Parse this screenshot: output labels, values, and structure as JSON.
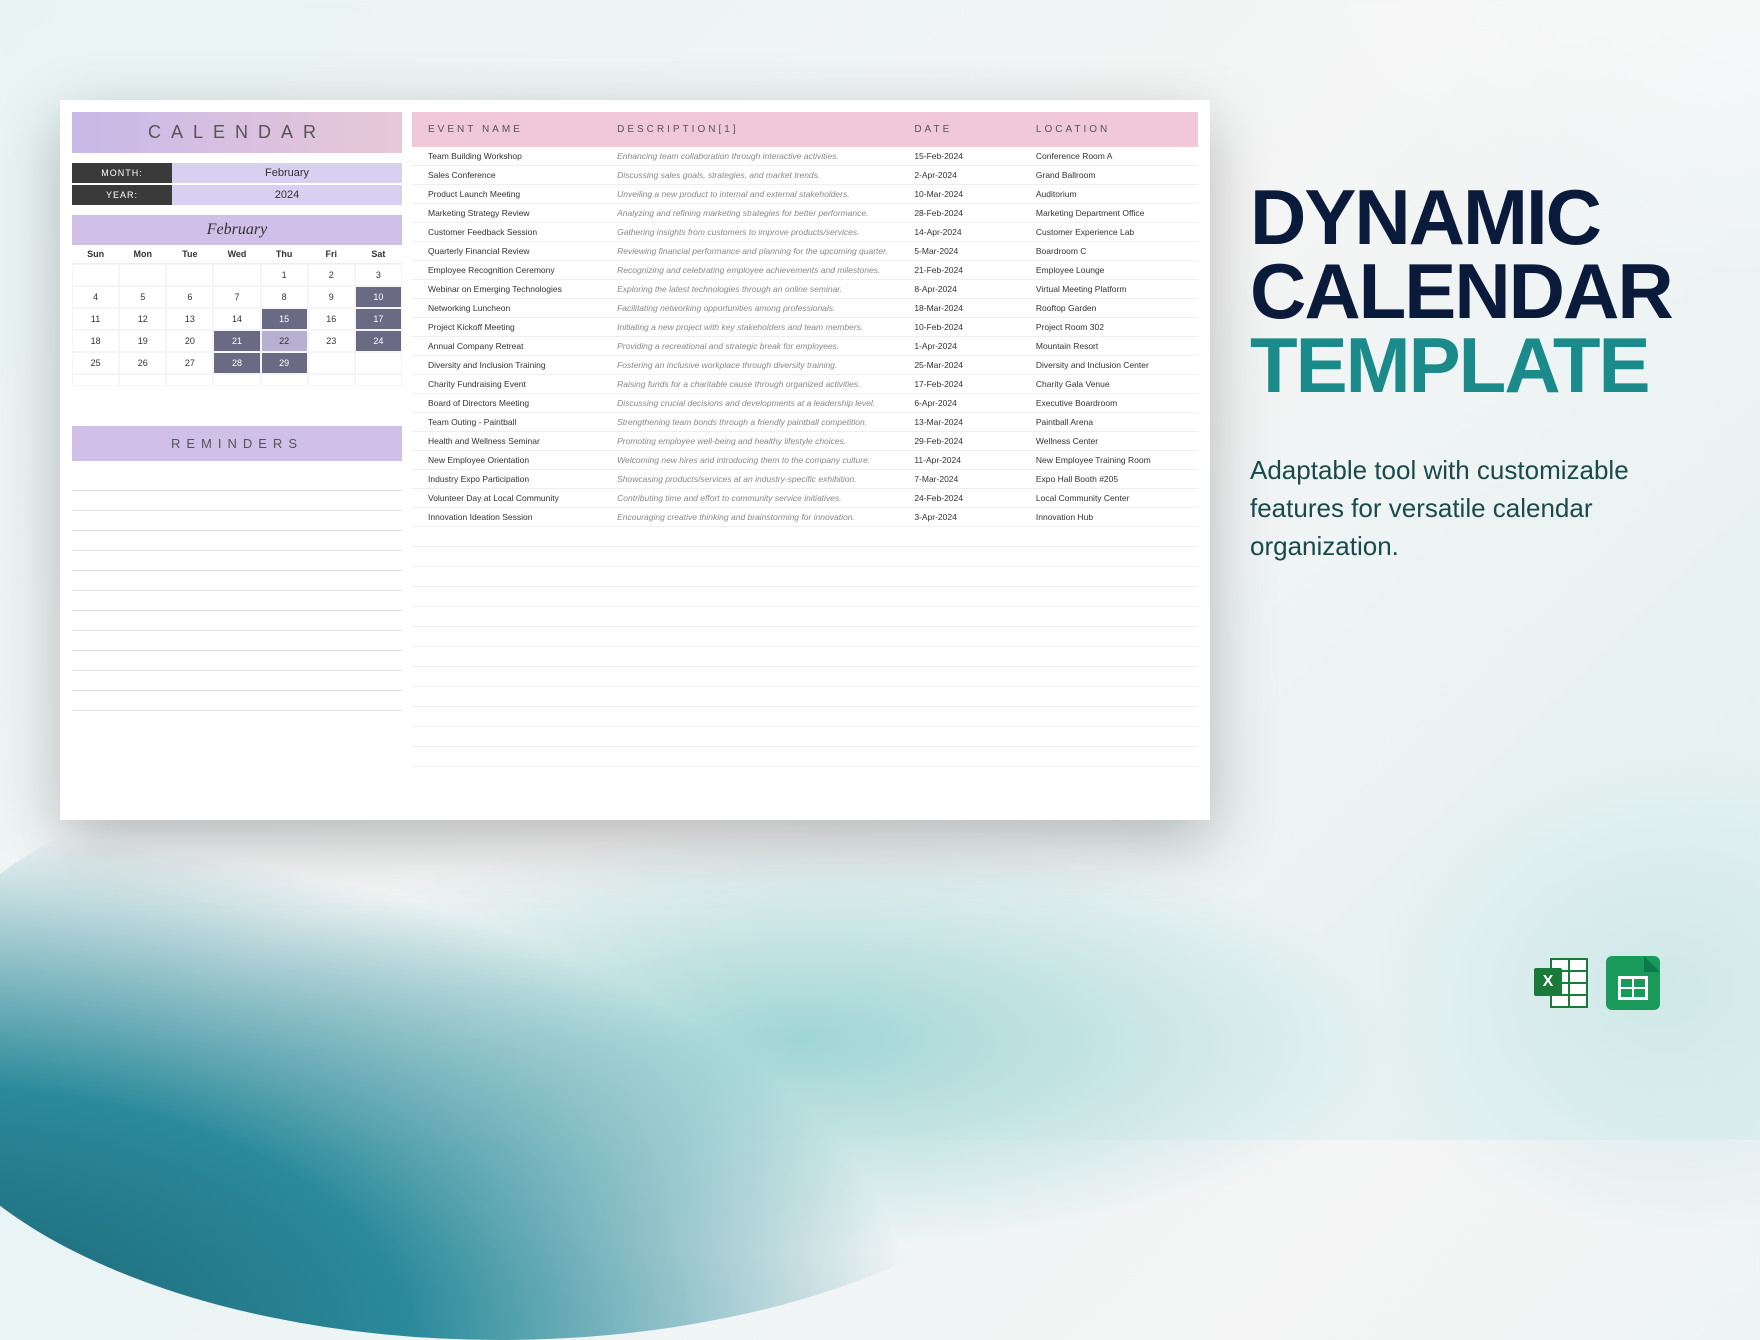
{
  "promo": {
    "title_line1": "DYNAMIC",
    "title_line2": "CALENDAR",
    "title_line3": "TEMPLATE",
    "description": "Adaptable tool with customizable features for versatile calendar organization."
  },
  "calendar": {
    "title": "CALENDAR",
    "month_label": "MONTH:",
    "month_value": "February",
    "year_label": "YEAR:",
    "year_value": "2024",
    "month_name": "February",
    "days": [
      "Sun",
      "Mon",
      "Tue",
      "Wed",
      "Thu",
      "Fri",
      "Sat"
    ],
    "grid": [
      [
        "",
        "",
        "",
        "",
        "1",
        "2",
        "3"
      ],
      [
        "4",
        "5",
        "6",
        "7",
        "8",
        "9",
        "10"
      ],
      [
        "11",
        "12",
        "13",
        "14",
        "15",
        "16",
        "17"
      ],
      [
        "18",
        "19",
        "20",
        "21",
        "22",
        "23",
        "24"
      ],
      [
        "25",
        "26",
        "27",
        "28",
        "29",
        "",
        ""
      ],
      [
        "",
        "",
        "",
        "",
        "",
        "",
        ""
      ]
    ],
    "highlights_dark": [
      "10",
      "15",
      "17",
      "21",
      "24",
      "28",
      "29"
    ],
    "highlights_light": [
      "22"
    ]
  },
  "reminders_title": "REMINDERS",
  "events": {
    "headers": [
      "EVENT NAME",
      "DESCRIPTION[1]",
      "DATE",
      "LOCATION"
    ],
    "rows": [
      {
        "name": "Team Building Workshop",
        "desc": "Enhancing team collaboration through interactive activities.",
        "date": "15-Feb-2024",
        "loc": "Conference Room A"
      },
      {
        "name": "Sales Conference",
        "desc": "Discussing sales goals, strategies, and market trends.",
        "date": "2-Apr-2024",
        "loc": "Grand Ballroom"
      },
      {
        "name": "Product Launch Meeting",
        "desc": "Unveiling a new product to internal and external stakeholders.",
        "date": "10-Mar-2024",
        "loc": "Auditorium"
      },
      {
        "name": "Marketing Strategy Review",
        "desc": "Analyzing and refining marketing strategies for better performance.",
        "date": "28-Feb-2024",
        "loc": "Marketing Department Office"
      },
      {
        "name": "Customer Feedback Session",
        "desc": "Gathering insights from customers to improve products/services.",
        "date": "14-Apr-2024",
        "loc": "Customer Experience Lab"
      },
      {
        "name": "Quarterly Financial Review",
        "desc": "Reviewing financial performance and planning for the upcoming quarter.",
        "date": "5-Mar-2024",
        "loc": "Boardroom C"
      },
      {
        "name": "Employee Recognition Ceremony",
        "desc": "Recognizing and celebrating employee achievements and milestones.",
        "date": "21-Feb-2024",
        "loc": "Employee Lounge"
      },
      {
        "name": "Webinar on Emerging Technologies",
        "desc": "Exploring the latest technologies through an online seminar.",
        "date": "8-Apr-2024",
        "loc": "Virtual Meeting Platform"
      },
      {
        "name": "Networking Luncheon",
        "desc": "Facilitating networking opportunities among professionals.",
        "date": "18-Mar-2024",
        "loc": "Rooftop Garden"
      },
      {
        "name": "Project Kickoff Meeting",
        "desc": "Initiating a new project with key stakeholders and team members.",
        "date": "10-Feb-2024",
        "loc": "Project Room 302"
      },
      {
        "name": "Annual Company Retreat",
        "desc": "Providing a recreational and strategic break for employees.",
        "date": "1-Apr-2024",
        "loc": "Mountain Resort"
      },
      {
        "name": "Diversity and Inclusion Training",
        "desc": "Fostering an inclusive workplace through diversity training.",
        "date": "25-Mar-2024",
        "loc": "Diversity and Inclusion Center"
      },
      {
        "name": "Charity Fundraising Event",
        "desc": "Raising funds for a charitable cause through organized activities.",
        "date": "17-Feb-2024",
        "loc": "Charity Gala Venue"
      },
      {
        "name": "Board of Directors Meeting",
        "desc": "Discussing crucial decisions and developments at a leadership level.",
        "date": "6-Apr-2024",
        "loc": "Executive Boardroom"
      },
      {
        "name": "Team Outing - Paintball",
        "desc": "Strengthening team bonds through a friendly paintball competition.",
        "date": "13-Mar-2024",
        "loc": "Paintball Arena"
      },
      {
        "name": "Health and Wellness Seminar",
        "desc": "Promoting employee well-being and healthy lifestyle choices.",
        "date": "29-Feb-2024",
        "loc": "Wellness Center"
      },
      {
        "name": "New Employee Orientation",
        "desc": "Welcoming new hires and introducing them to the company culture.",
        "date": "11-Apr-2024",
        "loc": "New Employee Training Room"
      },
      {
        "name": "Industry Expo Participation",
        "desc": "Showcasing products/services at an industry-specific exhibition.",
        "date": "7-Mar-2024",
        "loc": "Expo Hall Booth #205"
      },
      {
        "name": "Volunteer Day at Local Community",
        "desc": "Contributing time and effort to community service initiatives.",
        "date": "24-Feb-2024",
        "loc": "Local Community Center"
      },
      {
        "name": "Innovation Ideation Session",
        "desc": "Encouraging creative thinking and brainstorming for innovation.",
        "date": "3-Apr-2024",
        "loc": "Innovation Hub"
      }
    ]
  },
  "icons": {
    "excel": "X",
    "sheets": "sheets"
  }
}
